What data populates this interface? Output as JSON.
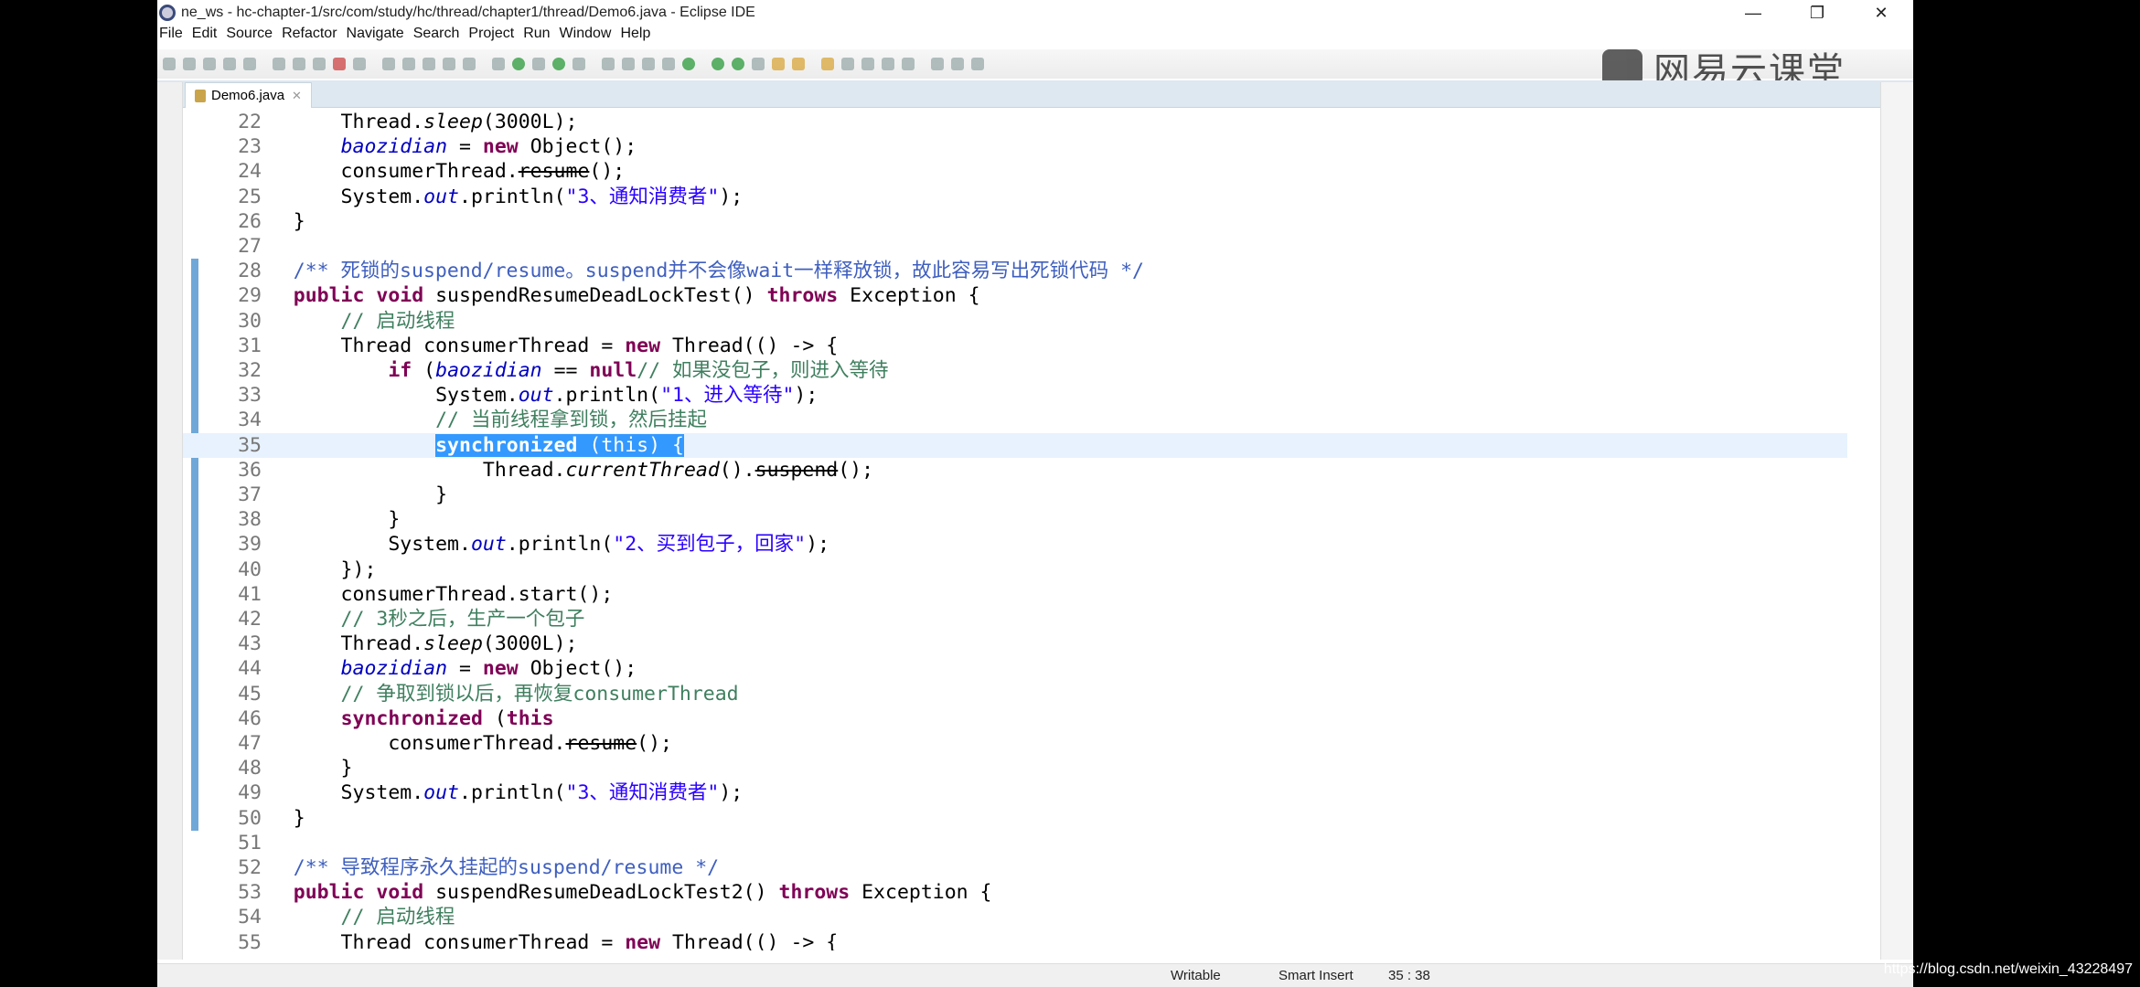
{
  "window": {
    "title": "ne_ws - hc-chapter-1/src/com/study/hc/thread/chapter1/thread/Demo6.java - Eclipse IDE",
    "controls": [
      "—",
      "❐",
      "✕"
    ]
  },
  "menu": [
    "File",
    "Edit",
    "Source",
    "Refactor",
    "Navigate",
    "Search",
    "Project",
    "Run",
    "Window",
    "Help"
  ],
  "toolbar_icons": [
    "new",
    "save",
    "save-all",
    "debug",
    "terminal",
    "skip",
    "resume",
    "suspend",
    "terminate",
    "disconnect",
    "step-into",
    "step-over",
    "step-return",
    "drop",
    "open-task",
    "mark-occurrences",
    "run-green",
    "toggle",
    "coverage",
    "pin",
    "highlight",
    "next-annotation",
    "prev-annotation",
    "pin-editor",
    "debug-run",
    "run",
    "coverage-run",
    "external-tools",
    "new-java",
    "new-package",
    "new-class",
    "open-type",
    "search",
    "refactor",
    "back",
    "forward",
    "last-edit",
    "perspective"
  ],
  "logo": "网易云课堂",
  "editor": {
    "tab_label": "Demo6.java",
    "lines": [
      {
        "n": "22",
        "t": [
          [
            "",
            "        Thread."
          ],
          [
            "i",
            "sleep"
          ],
          [
            "",
            "(3000L);"
          ]
        ]
      },
      {
        "n": "23",
        "t": [
          [
            "",
            "        "
          ],
          [
            "f",
            "baozidian"
          ],
          [
            "",
            " = "
          ],
          [
            "k",
            "new"
          ],
          [
            "",
            " Object();"
          ]
        ]
      },
      {
        "n": "24",
        "t": [
          [
            "",
            "        consumerThread."
          ],
          [
            "st",
            "resume"
          ],
          [
            "",
            "();"
          ]
        ]
      },
      {
        "n": "25",
        "t": [
          [
            "",
            "        System."
          ],
          [
            "f",
            "out"
          ],
          [
            "",
            ".println("
          ],
          [
            "s",
            "\"3、通知消费者\""
          ],
          [
            "",
            ");"
          ]
        ]
      },
      {
        "n": "26",
        "t": [
          [
            "",
            "    }"
          ]
        ]
      },
      {
        "n": "27",
        "t": []
      },
      {
        "n": "28",
        "t": [
          [
            "j",
            "    /** 死锁的suspend/resume。suspend并不会像wait一样释放锁，故此容易写出死锁代码 */"
          ]
        ]
      },
      {
        "n": "29",
        "t": [
          [
            "",
            "    "
          ],
          [
            "k",
            "public void"
          ],
          [
            "",
            " suspendResumeDeadLockTest() "
          ],
          [
            "k",
            "throws"
          ],
          [
            "",
            " Exception {"
          ]
        ]
      },
      {
        "n": "30",
        "t": [
          [
            "c",
            "        // 启动线程"
          ]
        ]
      },
      {
        "n": "31",
        "t": [
          [
            "",
            "        Thread consumerThread = "
          ],
          [
            "k",
            "new"
          ],
          [
            "",
            " Thread(() -> {"
          ]
        ]
      },
      {
        "n": "32",
        "t": [
          [
            "",
            "            "
          ],
          [
            "k",
            "if"
          ],
          [
            "",
            " ("
          ],
          [
            "f",
            "baozidian"
          ],
          [
            "",
            " == "
          ],
          [
            "k",
            "null"
          ],
          [
            ") { "
          ],
          [
            "c",
            "// 如果没包子，则进入等待"
          ]
        ]
      },
      {
        "n": "33",
        "t": [
          [
            "",
            "                System."
          ],
          [
            "f",
            "out"
          ],
          [
            "",
            ".println("
          ],
          [
            "s",
            "\"1、进入等待\""
          ],
          [
            "",
            ");"
          ]
        ]
      },
      {
        "n": "34",
        "t": [
          [
            "c",
            "                // 当前线程拿到锁，然后挂起"
          ]
        ]
      },
      {
        "n": "35",
        "t": [
          [
            "",
            "                "
          ],
          [
            "k sel",
            "synchronized"
          ],
          [
            "sel",
            " (this) {"
          ]
        ],
        "current": true
      },
      {
        "n": "36",
        "t": [
          [
            "",
            "                    Thread."
          ],
          [
            "i",
            "currentThread"
          ],
          [
            "",
            "()."
          ],
          [
            "st",
            "suspend"
          ],
          [
            "",
            "();"
          ]
        ]
      },
      {
        "n": "37",
        "t": [
          [
            "",
            "                }"
          ]
        ]
      },
      {
        "n": "38",
        "t": [
          [
            "",
            "            }"
          ]
        ]
      },
      {
        "n": "39",
        "t": [
          [
            "",
            "            System."
          ],
          [
            "f",
            "out"
          ],
          [
            "",
            ".println("
          ],
          [
            "s",
            "\"2、买到包子，回家\""
          ],
          [
            "",
            ");"
          ]
        ]
      },
      {
        "n": "40",
        "t": [
          [
            "",
            "        });"
          ]
        ]
      },
      {
        "n": "41",
        "t": [
          [
            "",
            "        consumerThread.start();"
          ]
        ]
      },
      {
        "n": "42",
        "t": [
          [
            "c",
            "        // 3秒之后，生产一个包子"
          ]
        ]
      },
      {
        "n": "43",
        "t": [
          [
            "",
            "        Thread."
          ],
          [
            "i",
            "sleep"
          ],
          [
            "",
            "(3000L);"
          ]
        ]
      },
      {
        "n": "44",
        "t": [
          [
            "",
            "        "
          ],
          [
            "f",
            "baozidian"
          ],
          [
            "",
            " = "
          ],
          [
            "k",
            "new"
          ],
          [
            "",
            " Object();"
          ]
        ]
      },
      {
        "n": "45",
        "t": [
          [
            "c",
            "        // 争取到锁以后，再恢复consumerThread"
          ]
        ]
      },
      {
        "n": "46",
        "t": [
          [
            "",
            "        "
          ],
          [
            "k",
            "synchronized"
          ],
          [
            "",
            " ("
          ],
          [
            "k",
            "this"
          ],
          [
            ") {"
          ]
        ]
      },
      {
        "n": "47",
        "t": [
          [
            "",
            "            consumerThread."
          ],
          [
            "st",
            "resume"
          ],
          [
            "",
            "();"
          ]
        ]
      },
      {
        "n": "48",
        "t": [
          [
            "",
            "        }"
          ]
        ]
      },
      {
        "n": "49",
        "t": [
          [
            "",
            "        System."
          ],
          [
            "f",
            "out"
          ],
          [
            "",
            ".println("
          ],
          [
            "s",
            "\"3、通知消费者\""
          ],
          [
            "",
            ");"
          ]
        ]
      },
      {
        "n": "50",
        "t": [
          [
            "",
            "    }"
          ]
        ]
      },
      {
        "n": "51",
        "t": []
      },
      {
        "n": "52",
        "t": [
          [
            "j",
            "    /** 导致程序永久挂起的suspend/resume */"
          ]
        ]
      },
      {
        "n": "53",
        "t": [
          [
            "",
            "    "
          ],
          [
            "k",
            "public void"
          ],
          [
            "",
            " suspendResumeDeadLockTest2() "
          ],
          [
            "k",
            "throws"
          ],
          [
            "",
            " Exception {"
          ]
        ]
      },
      {
        "n": "54",
        "t": [
          [
            "c",
            "        // 启动线程"
          ]
        ]
      },
      {
        "n": "55",
        "t": [
          [
            "",
            "        Thread consumerThread = "
          ],
          [
            "k",
            "new"
          ],
          [
            "",
            " Thread(() -> {"
          ]
        ]
      }
    ]
  },
  "status": {
    "mode": "Writable",
    "insert": "Smart Insert",
    "position": "35 : 38"
  },
  "watermark": "https://blog.csdn.net/weixin_43228497"
}
